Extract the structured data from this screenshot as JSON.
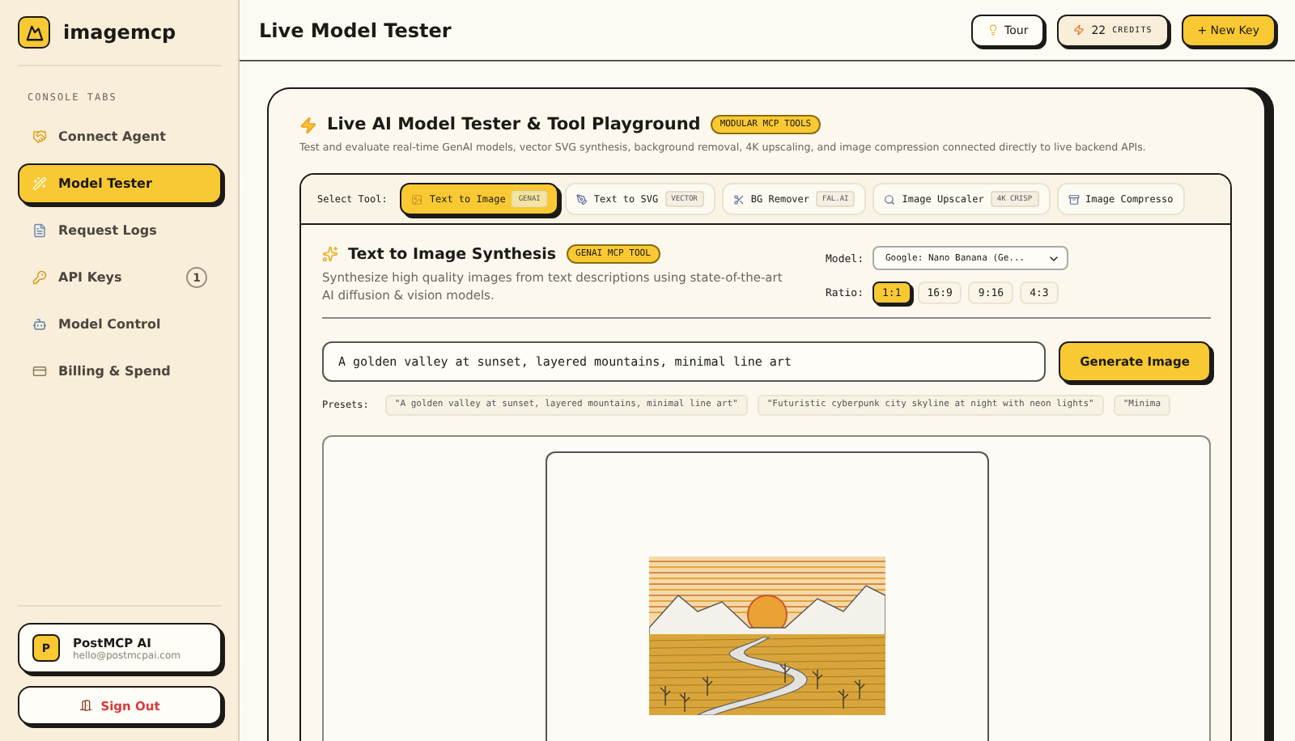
{
  "brand": {
    "name": "imagemcp"
  },
  "sidebar": {
    "section_title": "CONSOLE TABS",
    "items": [
      {
        "label": "Connect Agent",
        "selected": false
      },
      {
        "label": "Model Tester",
        "selected": true
      },
      {
        "label": "Request Logs",
        "selected": false
      },
      {
        "label": "API Keys",
        "selected": false,
        "count": "1"
      },
      {
        "label": "Model Control",
        "selected": false
      },
      {
        "label": "Billing & Spend",
        "selected": false
      }
    ],
    "user": {
      "initial": "P",
      "name": "PostMCP AI",
      "email": "hello@postmcpai.com"
    },
    "sign_out": "Sign Out"
  },
  "header": {
    "title": "Live Model Tester",
    "tour": "Tour",
    "credits": "22",
    "credits_label": "CREDITS",
    "new_key": "+ New Key"
  },
  "playground": {
    "title": "Live AI Model Tester & Tool Playground",
    "badge": "MODULAR MCP TOOLS",
    "description": "Test and evaluate real-time GenAI models, vector SVG synthesis, background removal, 4K upscaling, and image compression connected directly to live backend APIs.",
    "select_label": "Select Tool:",
    "tools": [
      {
        "label": "Text to Image",
        "tag": "GENAI",
        "selected": true
      },
      {
        "label": "Text to SVG",
        "tag": "VECTOR",
        "selected": false
      },
      {
        "label": "BG Remover",
        "tag": "FAL.AI",
        "selected": false
      },
      {
        "label": "Image Upscaler",
        "tag": "4K CRISP",
        "selected": false
      },
      {
        "label": "Image Compresso",
        "selected": false
      }
    ],
    "tool": {
      "title": "Text to Image Synthesis",
      "badge": "GENAI MCP TOOL",
      "description": "Synthesize high quality images from text descriptions using state-of-the-art AI diffusion & vision models.",
      "model_label": "Model:",
      "model": "Google: Nano Banana (Ge...",
      "ratio_label": "Ratio:",
      "ratios": [
        {
          "label": "1:1",
          "selected": true
        },
        {
          "label": "16:9",
          "selected": false
        },
        {
          "label": "9:16",
          "selected": false
        },
        {
          "label": "4:3",
          "selected": false
        }
      ],
      "prompt": "A golden valley at sunset, layered mountains, minimal line art",
      "generate": "Generate Image",
      "presets_label": "Presets:",
      "presets": [
        "\"A golden valley at sunset, layered mountains, minimal line art\"",
        "\"Futuristic cyberpunk city skyline at night with neon lights\"",
        "\"Minima"
      ]
    }
  }
}
